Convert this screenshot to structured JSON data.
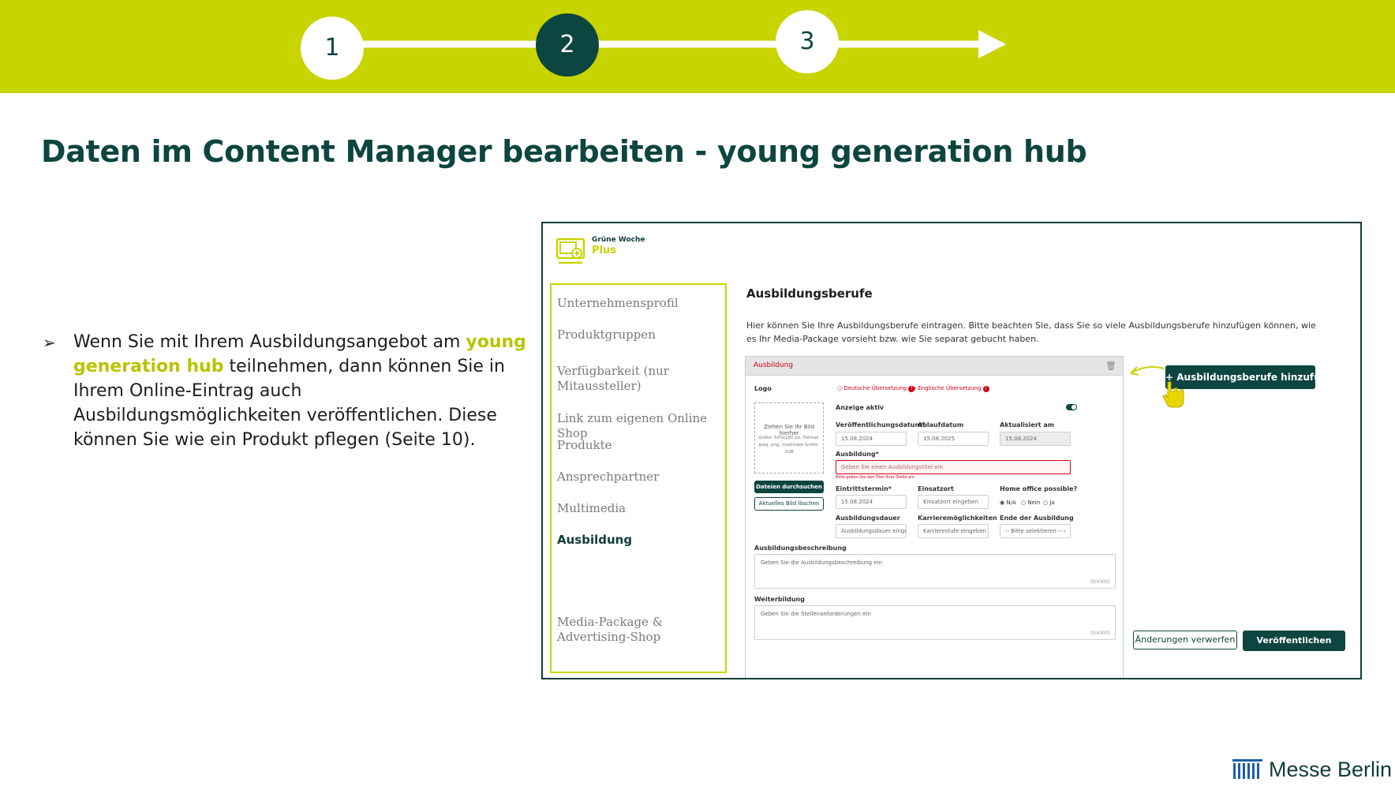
{
  "progress": {
    "steps": [
      "1",
      "2",
      "3"
    ],
    "current_step": "2",
    "colors": {
      "band": "#c8d400",
      "active": "#0d4540",
      "inactive": "#ffffff"
    }
  },
  "title": "Daten im Content Manager bearbeiten - young generation hub",
  "body": {
    "bullet": "➢",
    "before": "Wenn Sie mit Ihrem Ausbildungsangebot am ",
    "highlight": "young generation hub",
    "after": " teilnehmen, dann können Sie in Ihrem Online-Eintrag auch Ausbildungsmöglichkeiten veröffentlichen. Diese können Sie wie ein Produkt pflegen (Seite 10)."
  },
  "screenshot": {
    "logo": {
      "line1": "Grüne Woche",
      "line2": "Plus"
    },
    "sidebar": [
      "Unternehmensprofil",
      "Produktgruppen",
      "Verfügbarkeit (nur Mitaussteller)",
      "Link zum eigenen Online Shop",
      "Produkte",
      "Ansprechpartner",
      "Multimedia",
      "Ausbildung",
      "Media-Package & Advertising-Shop"
    ],
    "active_sidebar": "Ausbildung",
    "heading": "Ausbildungsberufe",
    "description": "Hier können Sie Ihre Ausbildungsberufe eintragen. Bitte beachten Sie, dass Sie so viele Ausbildungsberufe hinzufügen können, wie es Ihr Media-Package vorsieht bzw. wie Sie separat gebucht haben.",
    "card": {
      "header": "Ausbildung",
      "logo_label": "Logo",
      "lang_de": "Deutsche Übersetzung",
      "lang_en": "Englische Übersetzung",
      "drop_title": "Ziehen Sie Ihr Bild hierher",
      "drop_info": "Größe: 500x290 px, Format: jpeg, png, maximale Größe: 2GB",
      "browse_button": "Dateien durchsuchen",
      "delete_button": "Aktuelles Bild löschen",
      "anzeige_label": "Anzeige aktiv",
      "pub_date_label": "Veröffentlichungsdatum*",
      "pub_date": "15.08.2024",
      "exp_date_label": "Ablaufdatum",
      "exp_date": "15.08.2025",
      "updated_label": "Aktualisiert am",
      "updated": "15.08.2024",
      "ausbildung_label": "Ausbildung*",
      "ausbildung_placeholder": "Geben Sie einen Ausbildungstitel ein",
      "ausbildung_error": "Bitte geben Sie den Titel Ihrer Stelle ein",
      "start_label": "Eintrittstermin*",
      "start": "15.08.2024",
      "place_label": "Einsatzort",
      "place_placeholder": "Einsatzort eingeben",
      "home_label": "Home office possible?",
      "home_options": [
        "N/A",
        "Nein",
        "Ja"
      ],
      "duration_label": "Ausbildungsdauer",
      "duration_placeholder": "Ausbildungsdauer eingeb",
      "career_label": "Karrieremöglichkeiten",
      "career_placeholder": "Karrierestufe eingeben",
      "end_label": "Ende der Ausbildung",
      "end_select": "-- Bitte selektieren --",
      "desc_label": "Ausbildungsbeschreibung",
      "desc_placeholder": "Geben Sie die Ausbildungsbeschreibung ein",
      "desc_count": "(0/4000)",
      "further_label": "Weiterbildung",
      "further_placeholder": "Geben Sie die Stellenanforderungen ein",
      "further_count": "(0/4000)"
    },
    "add_button": "+ Ausbildungsberufe hinzufügen",
    "discard_button": "Änderungen verwerfen",
    "publish_button": "Veröffentlichen"
  },
  "footer": {
    "brand": "Messe Berlin"
  }
}
